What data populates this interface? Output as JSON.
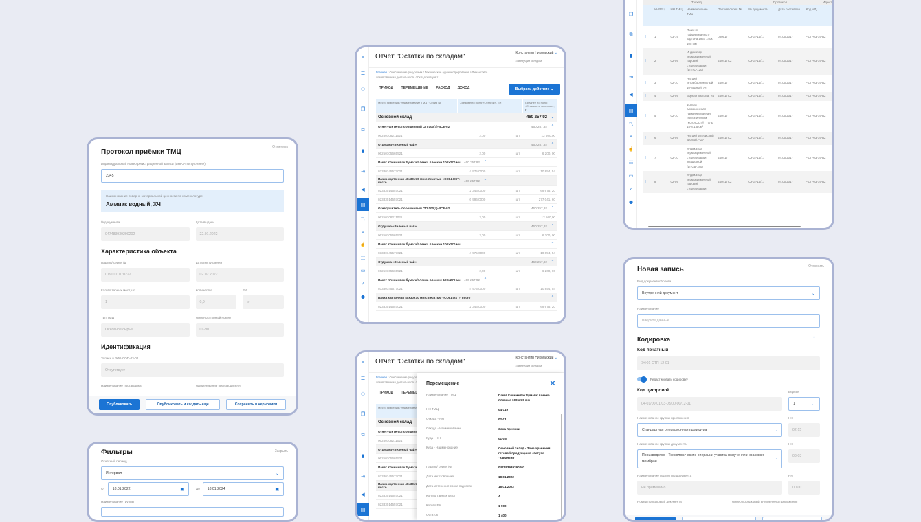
{
  "protocol": {
    "title": "Протокол приёмки ТМЦ",
    "cancel": "Отменить",
    "inrz_label": "Индивидуальный номер регистрационной записи (ИНРЗ-Поступление)",
    "inrz_value": "2345",
    "tmc_label": "Наименование товарно материальной ценности по номенклатуре",
    "tmc_value": "Аммиак водный, ХЧ",
    "doc_label": "№документа",
    "doc_value": "047483939290202",
    "issue_label": "Дата выдачи",
    "issue_value": "22.01.2022",
    "section_object": "Характеристика объекта",
    "batch_label": "Партия/ серия №",
    "batch_value": "0190101070222",
    "arrival_label": "Дата поступления",
    "arrival_value": "02.02.2022",
    "places_label": "Кол-во тарных мест, шт.",
    "places_value": "1",
    "qty_label": "Количество",
    "qty_value": "0,9",
    "unit_label": "ЕИ",
    "unit_value": "кг",
    "type_label": "Тип ТМЦ",
    "type_value": "Основное сырье",
    "nom_label": "Номенклатурный номер",
    "nom_value": "01-90",
    "section_ident": "Идентификация",
    "record_label": "Запись в ЭФ1-СОП-03-02",
    "record_value": "Отсутствует",
    "supplier_label": "Наименование поставщика",
    "maker_label": "Наименование производителя",
    "btn_publish": "Опубликовать",
    "btn_publish_new": "Опубликовать и создать еще",
    "btn_draft": "Сохранить в черновики"
  },
  "filters": {
    "title": "Фильтры",
    "close": "Закрыть",
    "period_label": "Отчетный период",
    "period_value": "Интервал",
    "from_label": "От",
    "from_value": "18.01.2022",
    "to_label": "До",
    "to_value": "18.01.2024",
    "group_label": "Наименование группы"
  },
  "report": {
    "title": "Отчёт \"Остатки по складам\"",
    "user_name": "Константин Никольский",
    "user_role": "Заведущий складом",
    "breadcrumbs": [
      "Главная",
      "Обеспечение ресурсами",
      "Техническое администрирование",
      "Финансово-хозяйственная деятельность",
      "Складской учёт"
    ],
    "tabs": [
      "ПРИХОД",
      "ПЕРЕМЕЩЕНИЕ",
      "РАСХОД",
      "ДОХОД"
    ],
    "action_button": "Выбрать действие",
    "columns": [
      "Место хранения / Наименование ТМЦ / Серия №",
      "Среднее по полю «Остаток», ЕИ",
      "Среднее по полю «Стоимость остатков», ₽"
    ],
    "rows": [
      {
        "kind": "grp",
        "name": "Основной склад",
        "total": "460 257,92",
        "caret": "down"
      },
      {
        "kind": "item",
        "name": "Огнетушитель порошковый ОП-100(з)-ВСЕ-02",
        "total": "460 257,92"
      },
      {
        "kind": "sub",
        "serial": "06250108211021",
        "qty": "2,00",
        "unit": "шт.",
        "cost": "12 500,00"
      },
      {
        "kind": "item",
        "name": "Отдушка «Зеленый чай»",
        "total": "460 257,92"
      },
      {
        "kind": "sub",
        "serial": "06250105665521",
        "qty": "2,00",
        "unit": "шт.",
        "cost": "6 200, 00"
      },
      {
        "kind": "item",
        "name": "Пакет Клинимпак бумага/пленка плоские 100x270 мм",
        "total": "460 257,92",
        "narrow": true
      },
      {
        "kind": "sub",
        "serial": "03330145577021",
        "qty": "4 975,0000",
        "unit": "шт.",
        "cost": "10 854, 54"
      },
      {
        "kind": "item",
        "name": "Пачка картонная 40x30x70 мм с печатью «COLLOST» micro",
        "total": "460 257,92",
        "narrow": true
      },
      {
        "kind": "sub",
        "serial": "02333014557021",
        "qty": "2 346,0000",
        "unit": "шт.",
        "cost": "69 675, 20"
      },
      {
        "kind": "sub",
        "serial": "02333014557021",
        "qty": "6 996,0000",
        "unit": "шт.",
        "cost": "277 041, 60"
      },
      {
        "kind": "item",
        "name": "Огнетушитель порошковый ОП-100(з)-ВСЕ-02",
        "total": "460 257,92"
      },
      {
        "kind": "sub",
        "serial": "06250108211021",
        "qty": "2,00",
        "unit": "шт.",
        "cost": "12 500,00"
      },
      {
        "kind": "item",
        "name": "Отдушка «Зеленый чай»",
        "total": "460 257,92"
      },
      {
        "kind": "sub",
        "serial": "06250105665521",
        "qty": "2,00",
        "unit": "шт.",
        "cost": "6 200, 00"
      },
      {
        "kind": "item",
        "name": "Пакет Клинимпак бумага/пленка плоские 100x270 мм",
        "total": ""
      },
      {
        "kind": "sub",
        "serial": "03330145577021",
        "qty": "4 975,0000",
        "unit": "шт.",
        "cost": "10 854, 54"
      },
      {
        "kind": "item",
        "name": "Отдушка «Зеленый чай»",
        "total": "460 257,92"
      },
      {
        "kind": "sub",
        "serial": "06250105665521",
        "qty": "2,00",
        "unit": "шт.",
        "cost": "6 200, 00"
      },
      {
        "kind": "item",
        "name": "Пакет Клинимпак бумага/пленка плоские 100x270 мм",
        "total": "460 257,92",
        "narrow": true
      },
      {
        "kind": "sub",
        "serial": "03330145577021",
        "qty": "4 975,0000",
        "unit": "шт.",
        "cost": "10 854, 54"
      },
      {
        "kind": "item",
        "name": "Пачка картонная 40x30x70 мм с печатью «COLLOST» micro",
        "total": ""
      },
      {
        "kind": "sub",
        "serial": "02333014557021",
        "qty": "2 346,0000",
        "unit": "шт.",
        "cost": "69 675, 20"
      }
    ]
  },
  "movement": {
    "title": "Перемещение",
    "fields": [
      {
        "k": "Наименование ТМЦ",
        "v": "Пакет Клинимпак бумага/ пленка плоские 100x270 мм"
      },
      {
        "k": "НН ТМЦ",
        "v": "04-119"
      },
      {
        "k": "Откуда - НН",
        "v": "02-01"
      },
      {
        "k": "Откуда - Наименование",
        "v": "Зона приемки"
      },
      {
        "k": "Куда - НН",
        "v": "01-05"
      },
      {
        "k": "Куда - Наименование",
        "v": "Основной склад - Зона хранения готовой продукции в статусе \"карантин\""
      },
      {
        "k": "Партия/ серия №",
        "v": "047483939290202"
      },
      {
        "k": "Дата изготовления",
        "v": "18.01.2022"
      },
      {
        "k": "Дата истечения срока годности",
        "v": "18.01.2022"
      },
      {
        "k": "Кол-во тарных мест",
        "v": "4"
      },
      {
        "k": "Кол-во ЕИ",
        "v": "1 900"
      },
      {
        "k": "Остаток",
        "v": "1 400"
      }
    ]
  },
  "registry": {
    "groups": [
      "Приход",
      "Протокол",
      "Идент"
    ],
    "columns": [
      "ИНРЗ",
      "НН ТМЦ",
      "Наименование ТМЦ",
      "Партия/ серия №",
      "№ документа",
      "Дата составлен.",
      "Код НД"
    ],
    "rows": [
      [
        "1",
        "03-79",
        "Ящик из гофрированного картона 195x 140x 105 мм",
        "030517",
        "СУ02-14/17",
        "04.05.2017",
        "--СП-03-79-В2"
      ],
      [
        "2",
        "02-09",
        "Индикатор термовременной паровой стерилизации (ИТПС-120)",
        "240417С2",
        "СУ02-14/17",
        "04.05.2017",
        "--СП-03-79-В2"
      ],
      [
        "3",
        "02-10",
        "Натрий тетраборнокислый 10-водный, хч",
        "240417",
        "СУ02-14/17",
        "04.05.2017",
        "--СП-03-79-В2"
      ],
      [
        "4",
        "02-09",
        "Борная кислота, Ч4",
        "240417С2",
        "СУ02-14/17",
        "04.05.2017",
        "--СП-03-79-В2"
      ],
      [
        "5",
        "02-10",
        "Фольга алюминиевая ламинированная полиэтиленом \"КОЛЛОСТ®\" Толь 15% 1,5 см²",
        "240417",
        "СУ02-14/17",
        "04.05.2017",
        "--СП-03-79-В2"
      ],
      [
        "6",
        "02-09",
        "Натрий углекислый кислый, ЧДА",
        "240417С2",
        "СУ02-14/17",
        "04.05.2017",
        "--СП-03-79-В2"
      ],
      [
        "7",
        "02-10",
        "Индикатор термовременной стерилизации воздушной (ИТСВ-180)",
        "240417",
        "СУ02-14/17",
        "04.05.2017",
        "--СП-03-79-В2"
      ],
      [
        "8",
        "02-09",
        "Индикатор термовременной паровой стерилизации",
        "240417С2",
        "СУ02-14/17",
        "04.05.2017",
        "--СП-03-79-В2"
      ]
    ]
  },
  "new_record": {
    "title": "Новая запись",
    "cancel": "Отменить",
    "doctype_label": "Вид документооборота",
    "doctype_value": "Внутренний документ",
    "name_label": "Наименование",
    "name_placeholder": "Введите данные",
    "coding_title": "Кодировка",
    "print_code_title": "Код печатный",
    "print_code_value": "ЭФ01-СТП-12-01",
    "toggle_label": "Редактировать кодировку",
    "digital_code_title": "Код цифровой",
    "digital_code_value": "04-01/00-01/03-03/00-00/12-01",
    "version_label": "Версия",
    "version_value": "1",
    "app_group_label": "Наименование группы приложения",
    "app_group_value": "Стандартная операционная процедура",
    "nn_label": "НН",
    "app_group_nn": "02-15",
    "doc_group_label": "Наименование группы документа",
    "doc_group_value": "Производство - Технологические операции участка получения и фасовки мембран",
    "doc_group_nn": "03-03",
    "subgroup_label": "Наименование подгруппы документа",
    "subgroup_value": "Не применимо",
    "subgroup_nn": "00-00",
    "seq_label": "Номер порядковый документа",
    "seq_app_label": "Номер порядковый внутреннего приложения"
  },
  "colors": {
    "accent": "#1b74d4",
    "frame": "#aab3d3",
    "header": "#e3f0fc"
  }
}
